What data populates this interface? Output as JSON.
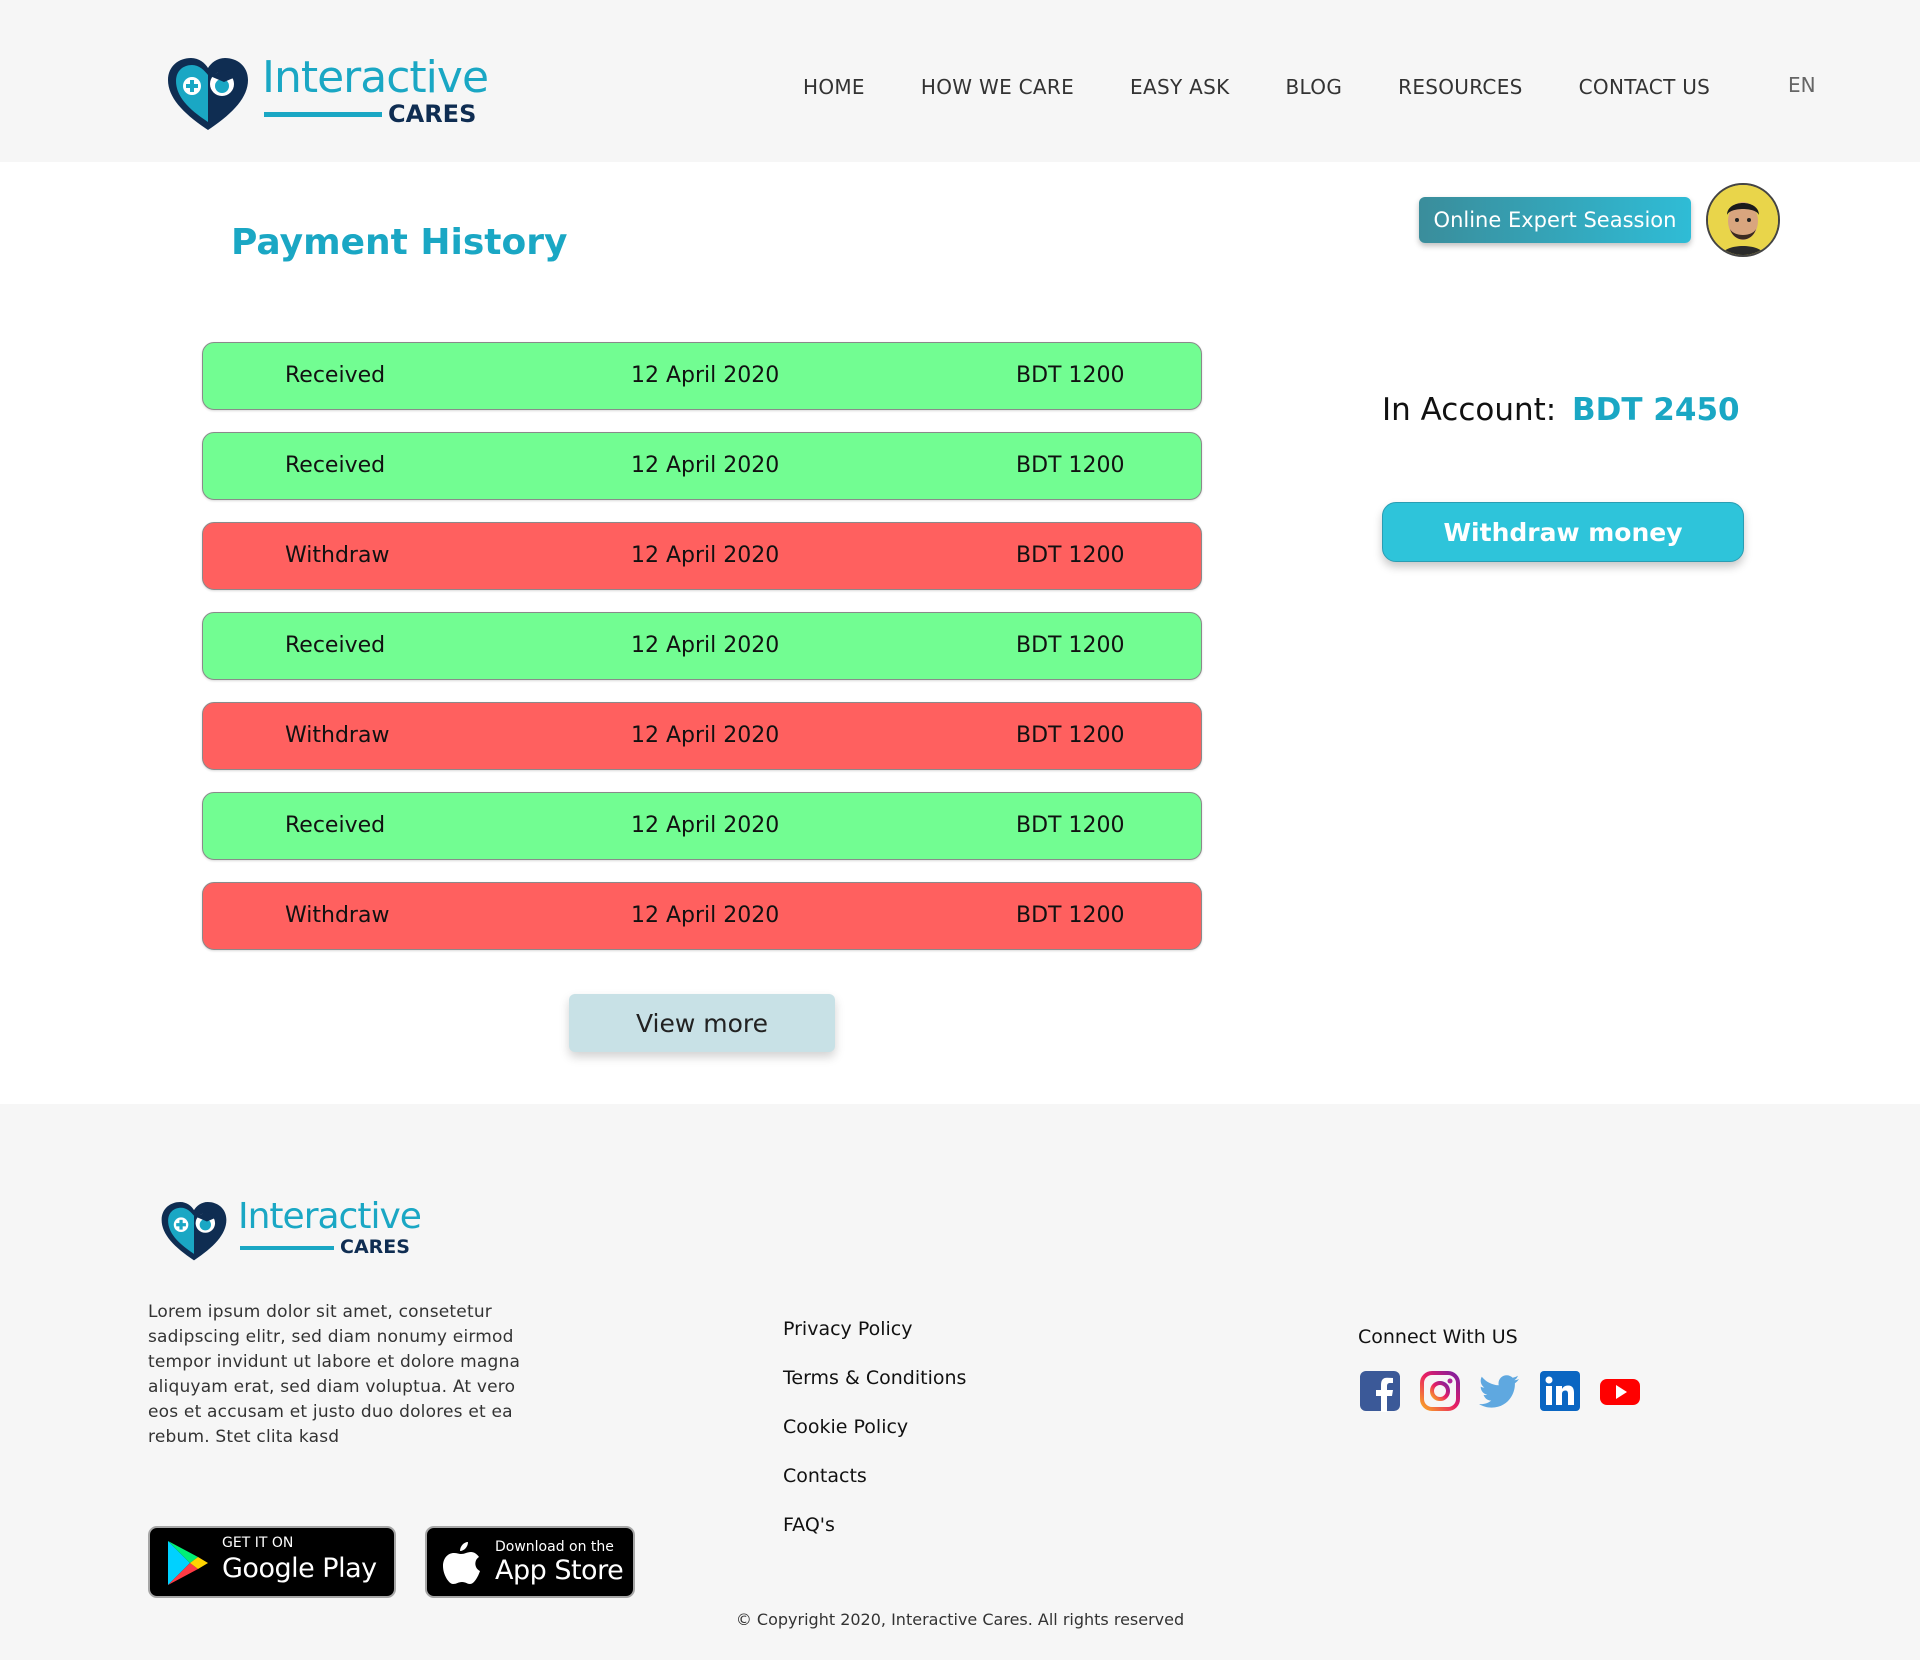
{
  "brand": {
    "logo_word": "Interactive",
    "logo_sub": "CARES"
  },
  "nav": {
    "items": [
      "HOME",
      "HOW WE CARE",
      "EASY ASK",
      "BLOG",
      "RESOURCES",
      "CONTACT US"
    ],
    "language": "EN"
  },
  "page": {
    "title": "Payment History"
  },
  "session": {
    "label": "Online Expert Seassion"
  },
  "transactions": [
    {
      "type": "Received",
      "date": "12 April 2020",
      "amount": "BDT 1200"
    },
    {
      "type": "Received",
      "date": "12 April 2020",
      "amount": "BDT 1200"
    },
    {
      "type": "Withdraw",
      "date": "12 April 2020",
      "amount": "BDT 1200"
    },
    {
      "type": "Received",
      "date": "12 April 2020",
      "amount": "BDT 1200"
    },
    {
      "type": "Withdraw",
      "date": "12 April 2020",
      "amount": "BDT 1200"
    },
    {
      "type": "Received",
      "date": "12 April 2020",
      "amount": "BDT 1200"
    },
    {
      "type": "Withdraw",
      "date": "12 April 2020",
      "amount": "BDT 1200"
    }
  ],
  "view_more": "View more",
  "account": {
    "label": "In Account:",
    "value": "BDT 2450",
    "withdraw_label": "Withdraw money"
  },
  "footer": {
    "description": "Lorem ipsum dolor sit amet, consetetur sadipscing elitr, sed diam nonumy eirmod tempor invidunt ut labore et dolore magna aliquyam erat, sed diam voluptua. At vero eos et accusam et justo duo dolores et ea rebum. Stet clita kasd",
    "links": [
      "Privacy Policy",
      "Terms & Conditions",
      "Cookie Policy",
      "Contacts",
      "FAQ's"
    ],
    "connect_label": "Connect With US",
    "socials": [
      "facebook-icon",
      "instagram-icon",
      "twitter-icon",
      "linkedin-icon",
      "youtube-icon"
    ],
    "google_play": {
      "small": "GET IT ON",
      "big": "Google Play"
    },
    "app_store": {
      "small": "Download on the",
      "big": "App Store"
    },
    "copyright": "© Copyright 2020, Interactive Cares. All rights reserved"
  },
  "colors": {
    "accent": "#1aa7c4",
    "received": "#72fd92",
    "withdraw": "#ff605f",
    "withdraw_button": "#2ec4da",
    "view_more_button": "#c8e1e6"
  }
}
